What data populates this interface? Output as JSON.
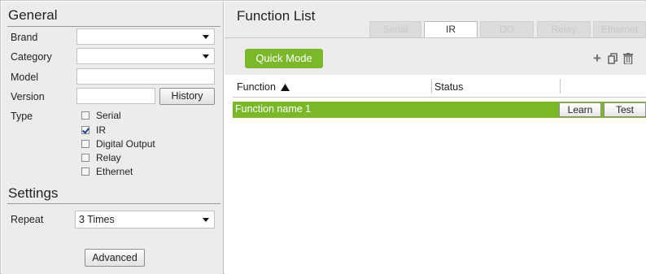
{
  "general": {
    "title": "General",
    "brand_label": "Brand",
    "brand_value": "",
    "category_label": "Category",
    "category_value": "",
    "model_label": "Model",
    "model_value": "",
    "version_label": "Version",
    "version_value": "",
    "history_button": "History",
    "type_label": "Type",
    "types": [
      {
        "label": "Serial",
        "checked": false
      },
      {
        "label": "IR",
        "checked": true
      },
      {
        "label": "Digital Output",
        "checked": false
      },
      {
        "label": "Relay",
        "checked": false
      },
      {
        "label": "Ethernet",
        "checked": false
      }
    ]
  },
  "settings": {
    "title": "Settings",
    "repeat_label": "Repeat",
    "repeat_value": "3 Times",
    "advanced_button": "Advanced"
  },
  "function_list": {
    "title": "Function List",
    "tabs": [
      {
        "label": "Serial",
        "active": false
      },
      {
        "label": "IR",
        "active": true
      },
      {
        "label": "DO",
        "active": false
      },
      {
        "label": "Relay",
        "active": false
      },
      {
        "label": "Ethernet",
        "active": false
      }
    ],
    "quick_mode_button": "Quick Mode",
    "icons": [
      "plus-icon",
      "copy-icon",
      "trash-icon"
    ],
    "columns": {
      "function": "Function",
      "function_sort_icon": "sort-up-icon",
      "status": "Status"
    },
    "rows": [
      {
        "function": "Function name 1",
        "status": "",
        "learn_button": "Learn",
        "test_button": "Test"
      }
    ]
  },
  "colors": {
    "accent_green": "#7ab82a",
    "panel_bg": "#ececec"
  }
}
